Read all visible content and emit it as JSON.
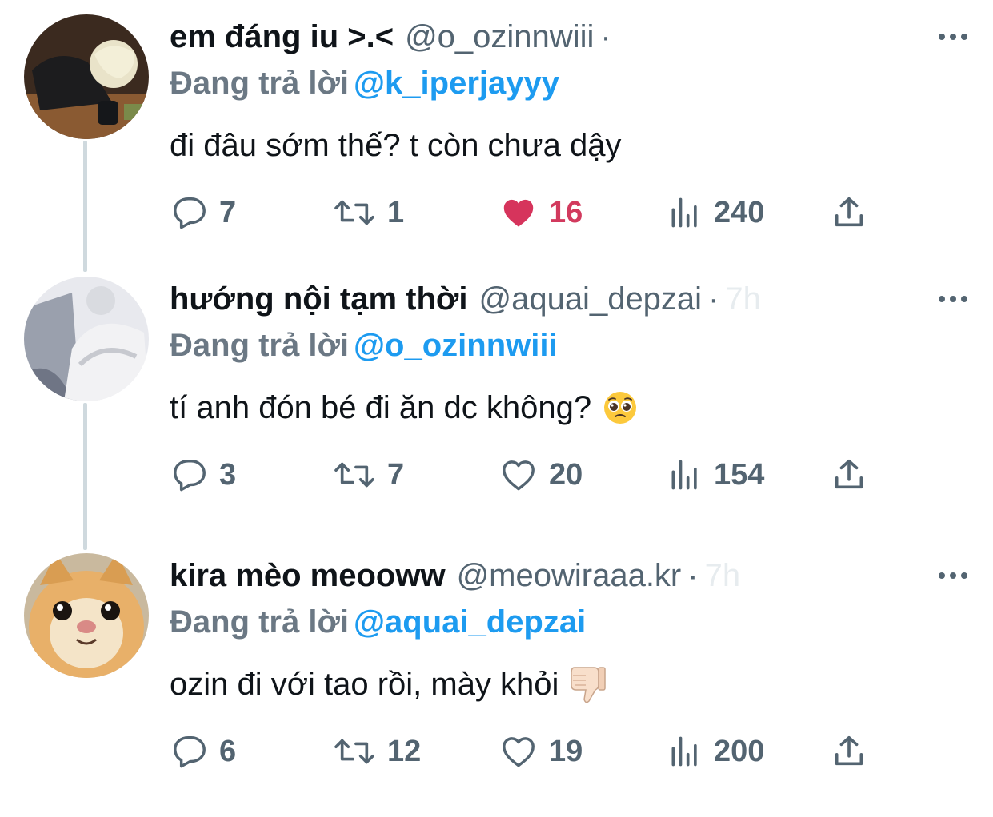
{
  "thread": {
    "tweets": [
      {
        "display_name": "em đáng iu >.<",
        "handle": "@o_ozinnwiii",
        "separator": "·",
        "time": "",
        "reply_prefix": "Đang trả lời",
        "reply_to": "@k_iperjayyy",
        "text": "đi đâu sớm thế? t còn chưa dậy",
        "emoji": "",
        "replies": "7",
        "retweets": "1",
        "likes": "16",
        "liked": true,
        "views": "240"
      },
      {
        "display_name": "hướng nội tạm thời",
        "handle": "@aquai_depzai",
        "separator": "·",
        "time": "7h",
        "reply_prefix": "Đang trả lời",
        "reply_to": "@o_ozinnwiii",
        "text": "tí anh đón bé đi ăn dc không?",
        "emoji": "pleading-face",
        "replies": "3",
        "retweets": "7",
        "likes": "20",
        "liked": false,
        "views": "154"
      },
      {
        "display_name": "kira mèo meooww",
        "handle": "@meowiraaa.kr",
        "separator": "·",
        "time": "7h",
        "reply_prefix": "Đang trả lời",
        "reply_to": "@aquai_depzai",
        "text": "ozin đi với tao rồi, mày khỏi",
        "emoji": "thumbs-down",
        "replies": "6",
        "retweets": "12",
        "likes": "19",
        "liked": false,
        "views": "200"
      }
    ]
  },
  "colors": {
    "text": "#0f1419",
    "secondary": "#536471",
    "link": "#1d9bf0",
    "like": "#f91880",
    "thread_line": "#cfd9de"
  },
  "icons": [
    "reply-icon",
    "retweet-icon",
    "heart-icon",
    "views-icon",
    "share-icon",
    "more-icon"
  ]
}
